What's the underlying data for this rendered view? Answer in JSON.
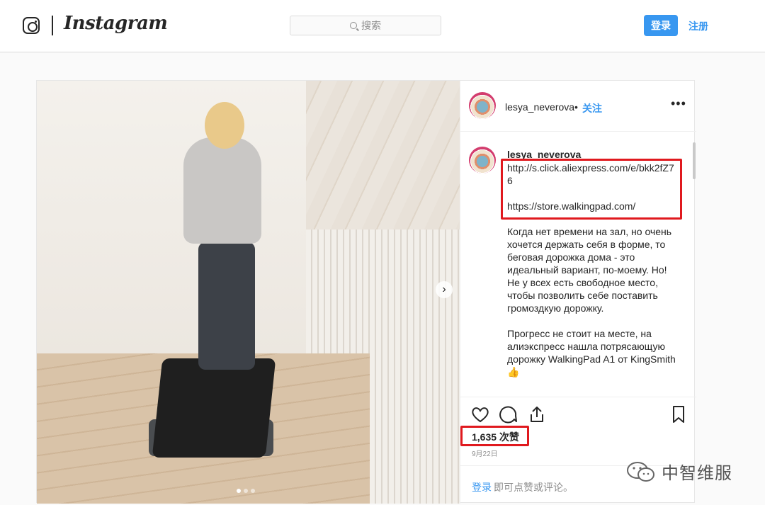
{
  "nav": {
    "wordmark": "Instagram",
    "search_placeholder": "搜索",
    "login_label": "登录",
    "signup_label": "注册"
  },
  "post": {
    "username": "lesya_neverova",
    "dot": "•",
    "follow_label": "关注",
    "more": "•••",
    "caption_user": "lesya_neverova",
    "caption_text": "http://s.click.aliexpress.com/e/bkk2fZ7\n6\n\nhttps://store.walkingpad.com/\n\nКогда нет времени на зал, но очень хочется держать себя в форме, то беговая дорожка дома - это идеальный вариант, по-моему. Но! Не у всех есть свободное место, чтобы позволить себе поставить громоздкую дорожку.\n\nПрогресс не стоит на месте, на алиэкспресс нашла потрясающую дорожку WalkingPad A1 от KingSmith\n👍",
    "likes": "1,635 次赞",
    "date": "9月22日",
    "login_link": "登录",
    "login_prompt": "即可点赞或评论。",
    "carousel_next": "›"
  },
  "watermark": {
    "text": "中智维服"
  },
  "colors": {
    "accent": "#3897f0",
    "highlight": "#e0191e"
  }
}
